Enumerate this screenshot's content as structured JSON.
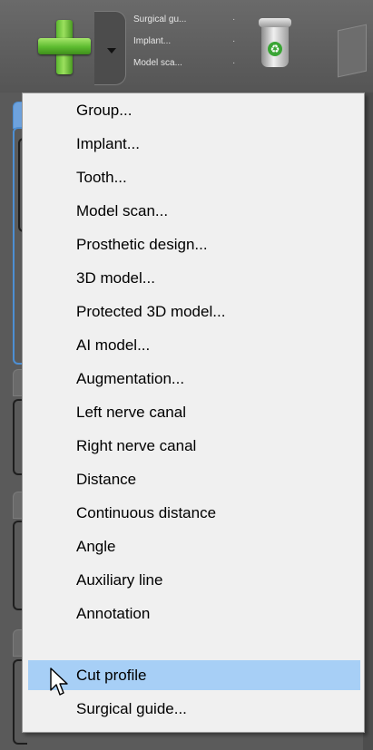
{
  "toolbar": {
    "recent_items": [
      "Surgical gu...",
      "Implant...",
      "Model sca..."
    ]
  },
  "menu": {
    "items": [
      {
        "label": "Group..."
      },
      {
        "label": "Implant..."
      },
      {
        "label": "Tooth..."
      },
      {
        "label": "Model scan..."
      },
      {
        "label": "Prosthetic design..."
      },
      {
        "label": "3D model..."
      },
      {
        "label": "Protected 3D model..."
      },
      {
        "label": "AI model..."
      },
      {
        "label": "Augmentation..."
      },
      {
        "label": "Left nerve canal"
      },
      {
        "label": "Right nerve canal"
      },
      {
        "label": "Distance"
      },
      {
        "label": "Continuous distance"
      },
      {
        "label": "Angle"
      },
      {
        "label": "Auxiliary line"
      },
      {
        "label": "Annotation"
      },
      {
        "label": "Cut profile",
        "highlighted": true
      },
      {
        "label": "Surgical guide..."
      }
    ]
  },
  "colors": {
    "menu_background": "#f0f0f0",
    "highlight": "#a7cff6",
    "add_icon_green": "#5bb82e",
    "panel_accent_blue": "#4d8fd4"
  },
  "icons": [
    "plus-icon",
    "chevron-down-icon",
    "trash-icon",
    "arrow-cursor-icon"
  ]
}
